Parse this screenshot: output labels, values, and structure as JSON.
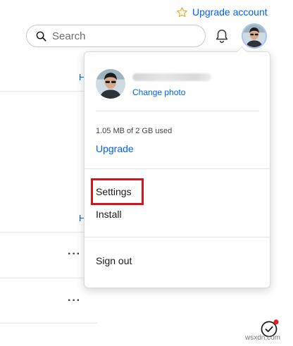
{
  "header": {
    "upgrade_account": "Upgrade account",
    "search_placeholder": "Search",
    "icons": {
      "star": "star-icon",
      "search": "search-icon",
      "bell": "bell-icon"
    }
  },
  "background_list": {
    "header_fragments": [
      "H",
      "H"
    ],
    "row_menu": "···"
  },
  "dropdown": {
    "change_photo": "Change photo",
    "usage": "1.05 MB of 2 GB used",
    "upgrade": "Upgrade",
    "settings": "Settings",
    "install": "Install",
    "sign_out": "Sign out",
    "highlight_color": "#d6141f"
  },
  "watermark": "wsxdn.com",
  "colors": {
    "link": "#0061fe",
    "star": "#e8b23a",
    "notification_dot": "#e0212b"
  }
}
